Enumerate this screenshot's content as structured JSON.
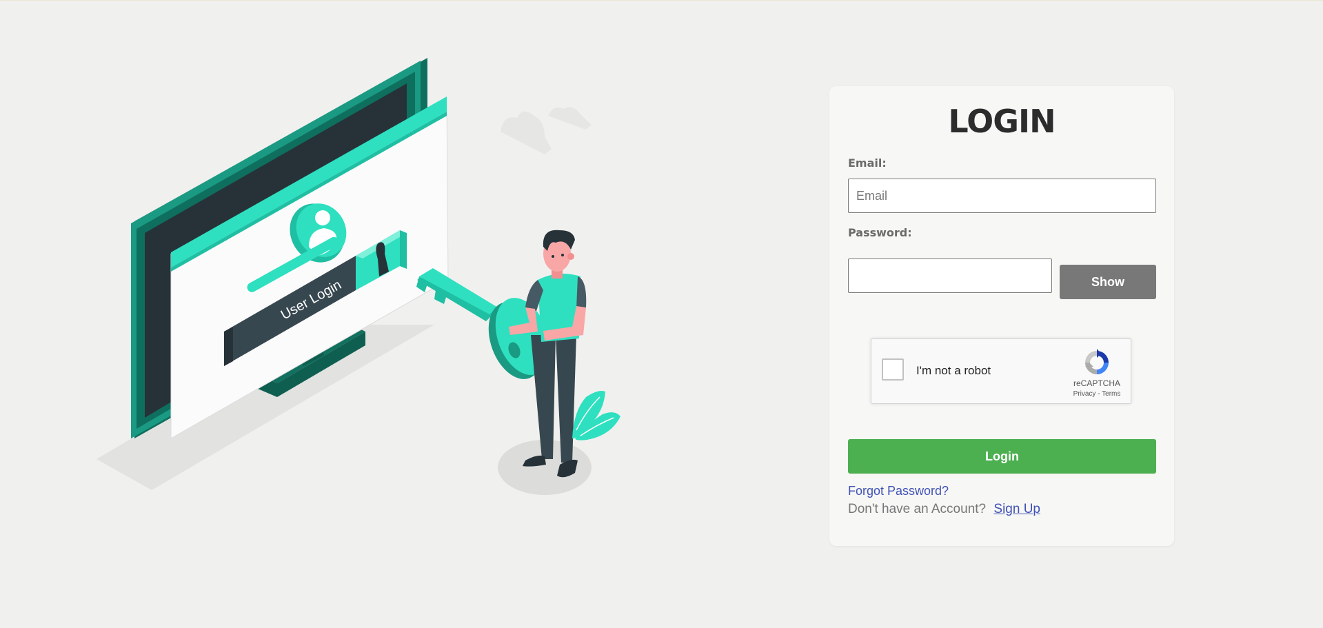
{
  "login_form": {
    "title": "LOGIN",
    "email_label": "Email:",
    "email_placeholder": "Email",
    "email_value": "",
    "password_label": "Password:",
    "password_value": "",
    "show_button_label": "Show",
    "recaptcha": {
      "checkbox_label": "I'm not a robot",
      "brand": "reCAPTCHA",
      "privacy_link": "Privacy",
      "separator": " - ",
      "terms_link": "Terms",
      "checked": false
    },
    "login_button_label": "Login",
    "forgot_password_link": "Forgot Password?",
    "signup_prompt": "Don't have an Account?",
    "signup_link": "Sign Up"
  },
  "illustration": {
    "screen_label": "User Login",
    "subject": "login-key-illustration"
  },
  "colors": {
    "background": "#f0f0ee",
    "card": "#f7f7f5",
    "accent_teal": "#2ee0c0",
    "dark_teal": "#1a9a82",
    "login_button": "#4caf50",
    "show_button": "#787878",
    "link": "#3f51b5"
  }
}
